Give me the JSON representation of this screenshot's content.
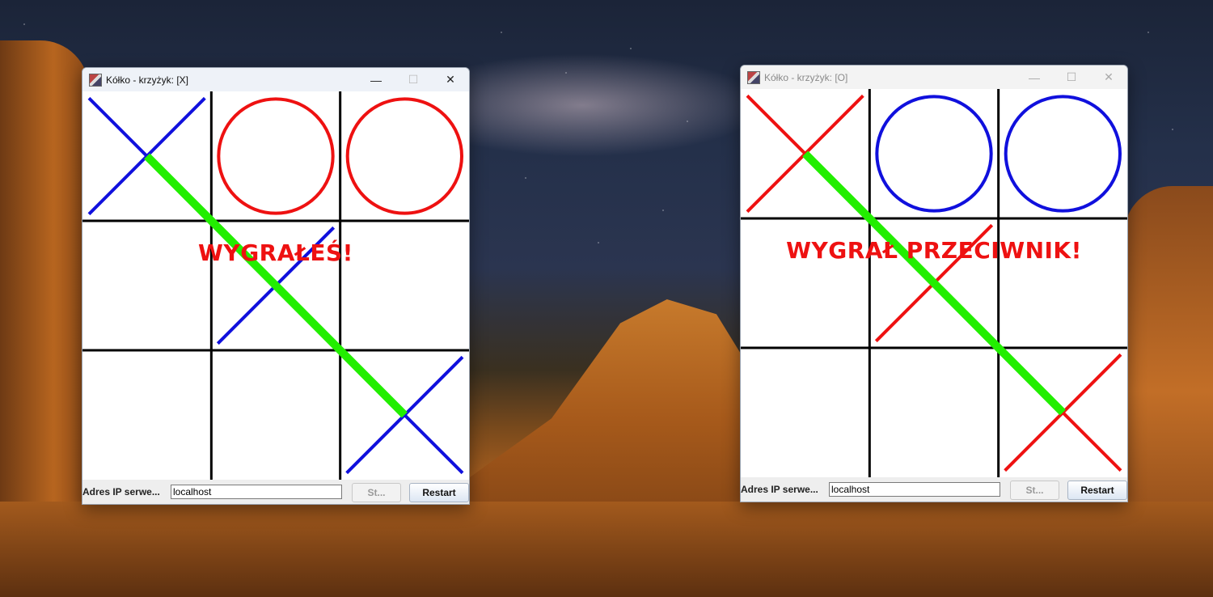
{
  "windows": [
    {
      "title": "Kółko - krzyżyk: [X]",
      "state": "active",
      "controls": {
        "minimize": "—",
        "maximize": "☐",
        "close": "✕"
      },
      "board": {
        "cells": [
          "X",
          "O",
          "O",
          "",
          "X",
          "",
          "",
          "",
          "X"
        ],
        "x_color": "#1010dd",
        "o_color": "#ee1111",
        "win_line": {
          "from_cell": 0,
          "to_cell": 8,
          "color": "#22ee00"
        }
      },
      "result_message": "WYGRAŁEŚ!",
      "bottom": {
        "ip_label": "Adres IP serwe...",
        "ip_value": "localhost",
        "start_label": "St...",
        "restart_label": "Restart"
      }
    },
    {
      "title": "Kółko - krzyżyk: [O]",
      "state": "inactive",
      "controls": {
        "minimize": "—",
        "maximize": "☐",
        "close": "✕"
      },
      "board": {
        "cells": [
          "X",
          "O",
          "O",
          "",
          "X",
          "",
          "",
          "",
          "X"
        ],
        "x_color": "#ee1111",
        "o_color": "#1010dd",
        "win_line": {
          "from_cell": 0,
          "to_cell": 8,
          "color": "#22ee00"
        }
      },
      "result_message": "WYGRAŁ PRZECIWNIK!",
      "bottom": {
        "ip_label": "Adres IP serwe...",
        "ip_value": "localhost",
        "start_label": "St...",
        "restart_label": "Restart"
      }
    }
  ]
}
